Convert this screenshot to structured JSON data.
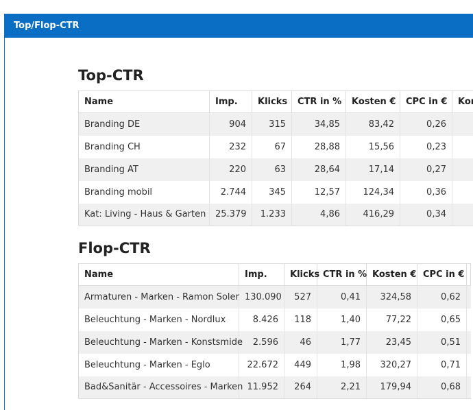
{
  "panel": {
    "title": "Top/Flop-CTR"
  },
  "top": {
    "title": "Top-CTR",
    "headers": [
      "Name",
      "Imp.",
      "Klicks",
      "CTR in %",
      "Kosten €",
      "CPC in €",
      "Kon"
    ],
    "rows": [
      [
        "Branding DE",
        "904",
        "315",
        "34,85",
        "83,42",
        "0,26"
      ],
      [
        "Branding CH",
        "232",
        "67",
        "28,88",
        "15,56",
        "0,23"
      ],
      [
        "Branding AT",
        "220",
        "63",
        "28,64",
        "17,14",
        "0,27"
      ],
      [
        "Branding mobil",
        "2.744",
        "345",
        "12,57",
        "124,34",
        "0,36"
      ],
      [
        "Kat: Living - Haus & Garten",
        "25.379",
        "1.233",
        "4,86",
        "416,29",
        "0,34"
      ]
    ]
  },
  "flop": {
    "title": "Flop-CTR",
    "headers": [
      "Name",
      "Imp.",
      "Klicks",
      "CTR in %",
      "Kosten €",
      "CPC in €"
    ],
    "rows": [
      [
        "Armaturen - Marken - Ramon Soler",
        "130.090",
        "527",
        "0,41",
        "324,58",
        "0,62"
      ],
      [
        "Beleuchtung - Marken - Nordlux",
        "8.426",
        "118",
        "1,40",
        "77,22",
        "0,65"
      ],
      [
        "Beleuchtung - Marken - Konstsmide",
        "2.596",
        "46",
        "1,77",
        "23,45",
        "0,51"
      ],
      [
        "Beleuchtung - Marken - Eglo",
        "22.672",
        "449",
        "1,98",
        "320,27",
        "0,71"
      ],
      [
        "Bad&Sanitär - Accessoires - Marken",
        "11.952",
        "264",
        "2,21",
        "179,94",
        "0,68"
      ]
    ]
  }
}
